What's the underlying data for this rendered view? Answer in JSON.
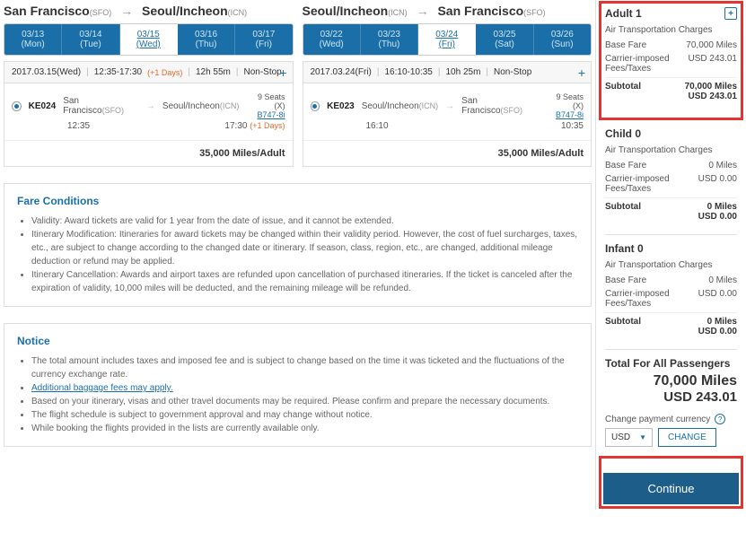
{
  "outbound": {
    "from": "San Francisco",
    "fromCode": "(SFO)",
    "to": "Seoul/Incheon",
    "toCode": "(ICN)",
    "dates": [
      {
        "date": "03/13",
        "day": "(Mon)"
      },
      {
        "date": "03/14",
        "day": "(Tue)"
      },
      {
        "date": "03/15",
        "day": "(Wed)"
      },
      {
        "date": "03/16",
        "day": "(Thu)"
      },
      {
        "date": "03/17",
        "day": "(Fri)"
      }
    ],
    "header": {
      "date": "2017.03.15(Wed)",
      "time": "12:35-17:30",
      "extra": "(+1 Days)",
      "dur": "12h 55m",
      "stop": "Non-Stop"
    },
    "flight": {
      "code": "KE024",
      "from": "San Francisco",
      "fromCode": "(SFO)",
      "to": "Seoul/Incheon",
      "toCode": "(ICN)",
      "seats": "9 Seats (X)",
      "plane": "B747-8i",
      "dep": "12:35",
      "arr": "17:30",
      "arrExtra": "(+1 Days)"
    },
    "miles": "35,000 Miles/Adult"
  },
  "inbound": {
    "from": "Seoul/Incheon",
    "fromCode": "(ICN)",
    "to": "San Francisco",
    "toCode": "(SFO)",
    "dates": [
      {
        "date": "03/22",
        "day": "(Wed)"
      },
      {
        "date": "03/23",
        "day": "(Thu)"
      },
      {
        "date": "03/24",
        "day": "(Fri)"
      },
      {
        "date": "03/25",
        "day": "(Sat)"
      },
      {
        "date": "03/26",
        "day": "(Sun)"
      }
    ],
    "header": {
      "date": "2017.03.24(Fri)",
      "time": "16:10-10:35",
      "extra": "",
      "dur": "10h 25m",
      "stop": "Non-Stop"
    },
    "flight": {
      "code": "KE023",
      "from": "Seoul/Incheon",
      "fromCode": "(ICN)",
      "to": "San Francisco",
      "toCode": "(SFO)",
      "seats": "9 Seats (X)",
      "plane": "B747-8i",
      "dep": "16:10",
      "arr": "10:35",
      "arrExtra": ""
    },
    "miles": "35,000 Miles/Adult"
  },
  "fare": {
    "title": "Fare Conditions",
    "items": [
      "Validity: Award tickets are valid for 1 year from the date of issue, and it cannot be extended.",
      "Itinerary Modification: Itineraries for award tickets may be changed within their validity period. However, the cost of fuel surcharges, taxes, etc., are subject to change according to the changed date or itinerary. If season, class, region, etc., are changed, additional mileage deduction or refund may be applied.",
      "Itinerary Cancellation: Awards and airport taxes are refunded upon cancellation of purchased itineraries. If the ticket is canceled after the expiration of validity, 10,000 miles will be deducted, and the remaining mileage will be refunded."
    ]
  },
  "notice": {
    "title": "Notice",
    "items": [
      "The total amount includes taxes and imposed fee and is subject to change based on the time it was ticketed and the fluctuations of the currency exchange rate.",
      "Additional baggage fees may apply.",
      "Based on your itinerary, visas and other travel documents may be required. Please confirm and prepare the necessary documents.",
      "The flight schedule is subject to government approval and may change without notice.",
      "While booking the flights provided in the lists are currently available only."
    ]
  },
  "pax": [
    {
      "title": "Adult 1",
      "charges": "Air Transportation Charges",
      "base": "70,000 Miles",
      "fees": "USD 243.01",
      "sub1": "70,000 Miles",
      "sub2": "USD 243.01",
      "showPlus": true
    },
    {
      "title": "Child 0",
      "charges": "Air Transportation Charges",
      "base": "0 Miles",
      "fees": "USD 0.00",
      "sub1": "0 Miles",
      "sub2": "USD 0.00",
      "showPlus": false
    },
    {
      "title": "Infant 0",
      "charges": "Air Transportation Charges",
      "base": "0 Miles",
      "fees": "USD 0.00",
      "sub1": "0 Miles",
      "sub2": "USD 0.00",
      "showPlus": false
    }
  ],
  "labels": {
    "baseFare": "Base Fare",
    "fees": "Carrier-imposed Fees/Taxes",
    "subtotal": "Subtotal"
  },
  "total": {
    "title": "Total For All Passengers",
    "miles": "70,000 Miles",
    "usd": "USD 243.01"
  },
  "currency": {
    "label": "Change payment currency",
    "selected": "USD",
    "change": "CHANGE"
  },
  "continue": "Continue"
}
